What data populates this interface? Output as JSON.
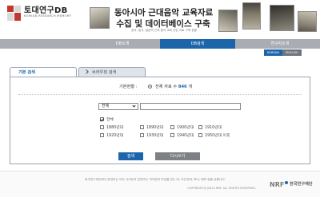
{
  "header": {
    "logo_title": "토대연구DB",
    "logo_subtitle": "KOREAN RESEARCH MEMORY",
    "title_line1": "동아시아 근대음악 교육자료",
    "title_line2": "수집 및 데이터베이스 구축",
    "description": "한국, 중국, 일본의 근대 음악 교육 관련 자료 구축 현황"
  },
  "nav": {
    "items": [
      {
        "label": "DB소개"
      },
      {
        "label": "DB검색"
      },
      {
        "label": "연구자소개"
      }
    ],
    "active_index": 1,
    "lang_korean": "KOREAN",
    "lang_english": "ENGLISH"
  },
  "search": {
    "tab_basic": "기본 검색",
    "tab_browse": "브라우징 검색",
    "basis_label": "기본현황 :",
    "basis_option_prefix": "전체 자료 수",
    "basis_count": "846",
    "basis_unit": "개",
    "field_select": "전체",
    "keyword_value": "",
    "check_all": "전체",
    "periods": [
      "1880년대",
      "1890년대",
      "1900년대",
      "1910년대",
      "1920년대",
      "1930년대",
      "1940년대",
      "1950년대 이후"
    ],
    "button_search": "검색",
    "button_reset": "다시쓰기"
  },
  "footer": {
    "notice": "한국연구재단에서 운영하는 모든 사이트의 콘텐츠는 저작권의 보호를 받는 바, 무단전재, 복사, 배포 등을 금합니다.",
    "copyright": "COPYRIGHT(C)2012 NRF. ALL RIGHTS RESERVED.",
    "org_name": "한국연구재단"
  },
  "colors": {
    "accent_blue": "#1d65ab",
    "nav_gray": "#a9adb3",
    "reset_gray": "#7d8185"
  }
}
